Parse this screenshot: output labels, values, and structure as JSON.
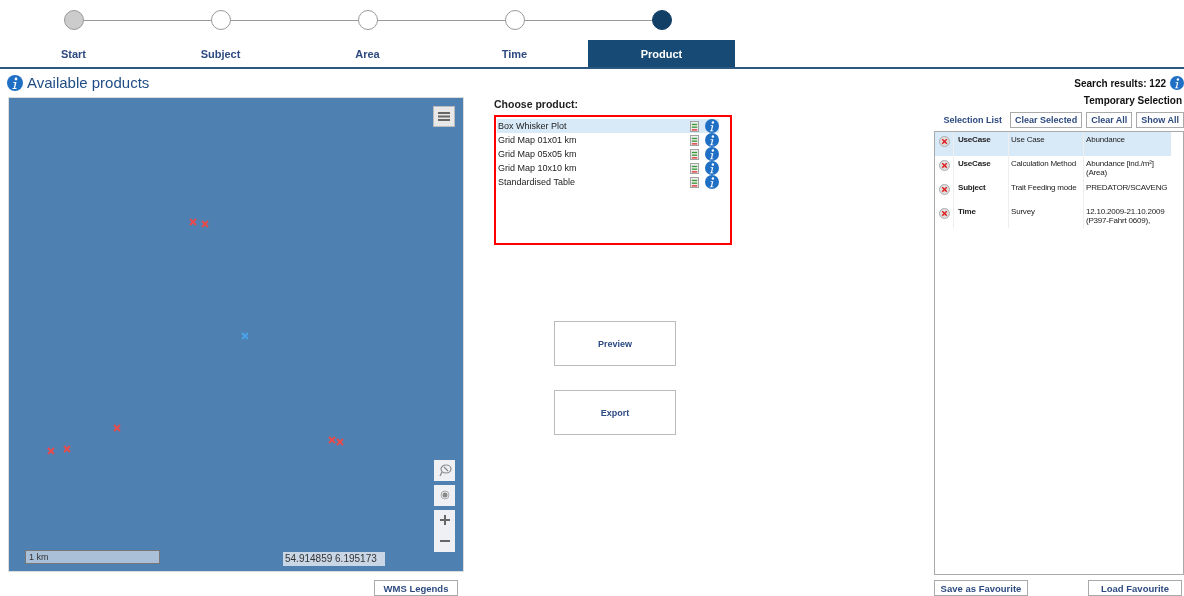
{
  "steps": [
    {
      "label": "Start",
      "completed": true,
      "selected": false
    },
    {
      "label": "Subject",
      "completed": false,
      "selected": false
    },
    {
      "label": "Area",
      "completed": false,
      "selected": false
    },
    {
      "label": "Time",
      "completed": false,
      "selected": false
    },
    {
      "label": "Product",
      "completed": false,
      "selected": true
    }
  ],
  "products_panel": {
    "title": "Available products"
  },
  "map": {
    "scale": "1 km",
    "coordinates": "54.914859  6.195173",
    "markers": [
      {
        "color": "#e84b4b"
      },
      {
        "color": "#e84b4b"
      },
      {
        "color": "#4aa3e8"
      },
      {
        "color": "#e84b4b"
      },
      {
        "color": "#e84b4b"
      },
      {
        "color": "#e84b4b"
      },
      {
        "color": "#e84b4b"
      },
      {
        "color": "#e84b4b"
      }
    ]
  },
  "wms_button": "WMS Legends",
  "choose_product": {
    "label": "Choose product:",
    "items": [
      {
        "name": "Box Whisker Plot",
        "selected": true
      },
      {
        "name": "Grid Map 01x01 km",
        "selected": false
      },
      {
        "name": "Grid Map 05x05 km",
        "selected": false
      },
      {
        "name": "Grid Map 10x10 km",
        "selected": false
      },
      {
        "name": "Standardised Table",
        "selected": false
      }
    ]
  },
  "actions": [
    "Preview",
    "Export"
  ],
  "search_results": "Search results: 122",
  "temporary_selection": "Temporary Selection",
  "selection_list": {
    "label": "Selection List",
    "buttons": [
      "Clear Selected",
      "Clear All",
      "Show All"
    ],
    "rows": [
      {
        "category": "UseCase",
        "attribute": "Use Case",
        "value": "Abundance",
        "selected": true
      },
      {
        "category": "UseCase",
        "attribute": "Calculation Method",
        "value": "Abundance [ind./m²] (Area)",
        "selected": false
      },
      {
        "category": "Subject",
        "attribute": "Trait Feeding mode",
        "value": "PREDATOR/SCAVENG",
        "selected": false
      },
      {
        "category": "Time",
        "attribute": "Survey",
        "value": "12.10.2009-21.10.2009 (P397-Fahrt 0609),",
        "selected": false
      }
    ]
  },
  "bottom_buttons": [
    "Save as Favourite",
    "Load Favourite"
  ]
}
